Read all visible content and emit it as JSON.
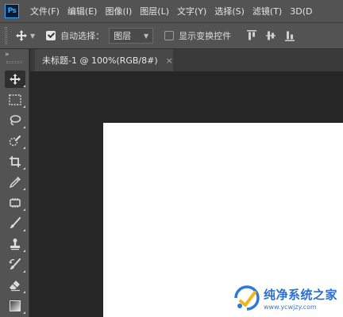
{
  "app": {
    "logo_text": "Ps"
  },
  "menu": [
    "文件(F)",
    "编辑(E)",
    "图像(I)",
    "图层(L)",
    "文字(Y)",
    "选择(S)",
    "滤镜(T)",
    "3D(D"
  ],
  "options": {
    "tool_icon": "move-tool-icon",
    "auto_select_label": "自动选择：",
    "auto_select_checked": true,
    "auto_select_target": "图层",
    "show_transform_label": "显示变换控件",
    "show_transform_checked": false,
    "align_icons": [
      "align-top-edges-icon",
      "align-vertical-centers-icon",
      "align-bottom-edges-icon"
    ]
  },
  "toolbar": {
    "collapse_glyph": "»",
    "tools": [
      "move-tool",
      "rectangular-marquee-tool",
      "lasso-tool",
      "quick-selection-tool",
      "crop-tool",
      "eyedropper-tool",
      "spot-healing-brush-tool",
      "brush-tool",
      "clone-stamp-tool",
      "history-brush-tool",
      "eraser-tool",
      "gradient-tool"
    ],
    "active_tool": "move-tool"
  },
  "document": {
    "tab_title": "未标题-1 @ 100%(RGB/8#)",
    "close_glyph": "×",
    "canvas_color": "#ffffff"
  },
  "watermark": {
    "title": "纯净系统之家",
    "url": "www.ycwjzy.com"
  },
  "colors": {
    "chrome": "#535353",
    "workspace": "#262626",
    "accent": "#31a8ff"
  }
}
